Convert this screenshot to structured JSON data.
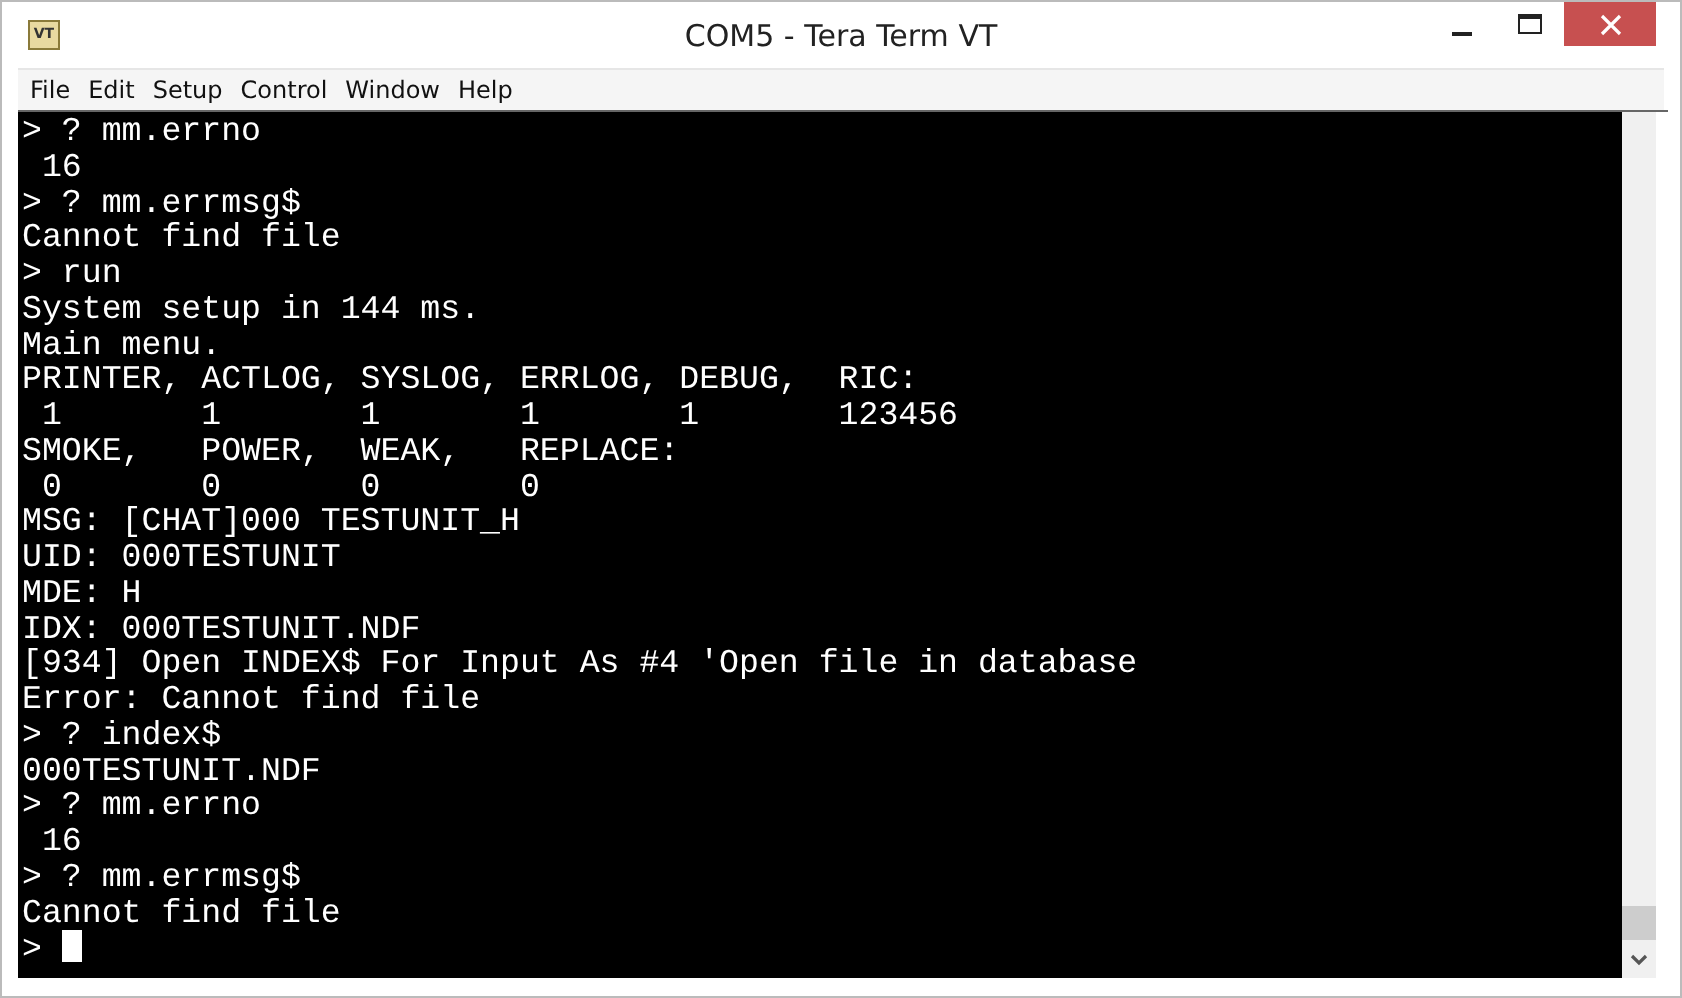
{
  "window": {
    "app_icon_text": "VT",
    "title": "COM5 - Tera Term VT"
  },
  "menu": [
    "File",
    "Edit",
    "Setup",
    "Control",
    "Window",
    "Help"
  ],
  "terminal": {
    "lines": [
      "> ? mm.errno",
      " 16",
      "> ? mm.errmsg$",
      "Cannot find file",
      "> run",
      "System setup in 144 ms.",
      "Main menu.",
      "PRINTER, ACTLOG, SYSLOG, ERRLOG, DEBUG,  RIC:",
      " 1       1       1       1       1       123456",
      "SMOKE,   POWER,  WEAK,   REPLACE:",
      " 0       0       0       0",
      "MSG: [CHAT]000 TESTUNIT_H",
      "UID: 000TESTUNIT",
      "MDE: H",
      "IDX: 000TESTUNIT.NDF",
      "[934] Open INDEX$ For Input As #4 'Open file in database",
      "Error: Cannot find file",
      "> ? index$",
      "000TESTUNIT.NDF",
      "> ? mm.errno",
      " 16",
      "> ? mm.errmsg$",
      "Cannot find file"
    ],
    "prompt": ">"
  }
}
